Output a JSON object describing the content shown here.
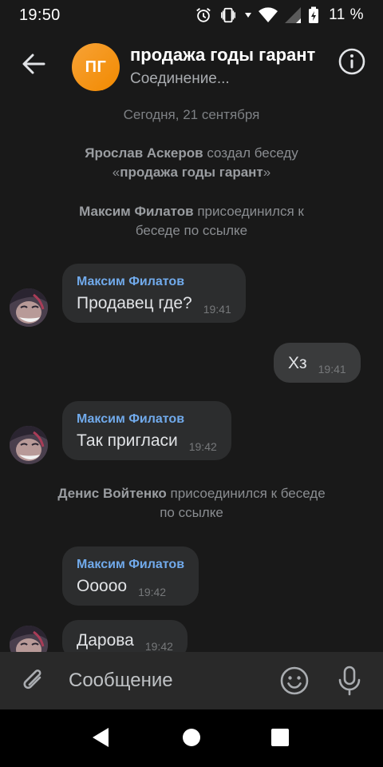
{
  "status_bar": {
    "time": "19:50",
    "battery": "11 %",
    "icons": [
      "alarm-icon",
      "vibrate-icon",
      "wifi-icon",
      "signal-icon",
      "battery-charging-icon"
    ]
  },
  "header": {
    "avatar_initials": "ПГ",
    "title": "продажа годы гарант",
    "subtitle": "Соединение..."
  },
  "messages": {
    "date": "Сегодня, 21 сентября",
    "service1": {
      "actor": "Ярослав Аскеров",
      "text": " создал беседу",
      "quote_open": "«",
      "chat_name": "продажа годы гарант",
      "quote_close": "»"
    },
    "service2": {
      "actor": "Максим Филатов",
      "text": " присоединился к беседе по ссылке"
    },
    "service3": {
      "actor": "Денис Войтенко",
      "text": " присоединился к беседе по ссылке"
    },
    "msg1": {
      "sender": "Максим Филатов",
      "text": "Продавец где?",
      "time": "19:41"
    },
    "msg2": {
      "text": "Хз",
      "time": "19:41"
    },
    "msg3": {
      "sender": "Максим Филатов",
      "text": "Так пригласи",
      "time": "19:42"
    },
    "msg4": {
      "sender": "Максим Филатов",
      "text": "Ооооо",
      "time": "19:42"
    },
    "msg5": {
      "text": "Дарова",
      "time": "19:42"
    }
  },
  "composer": {
    "placeholder": "Сообщение"
  },
  "colors": {
    "background": "#191919",
    "bubble_in": "#2c2d2e",
    "bubble_out": "#3a3b3c",
    "sender_name": "#71aaeb",
    "avatar_orange": "#f28a00"
  }
}
